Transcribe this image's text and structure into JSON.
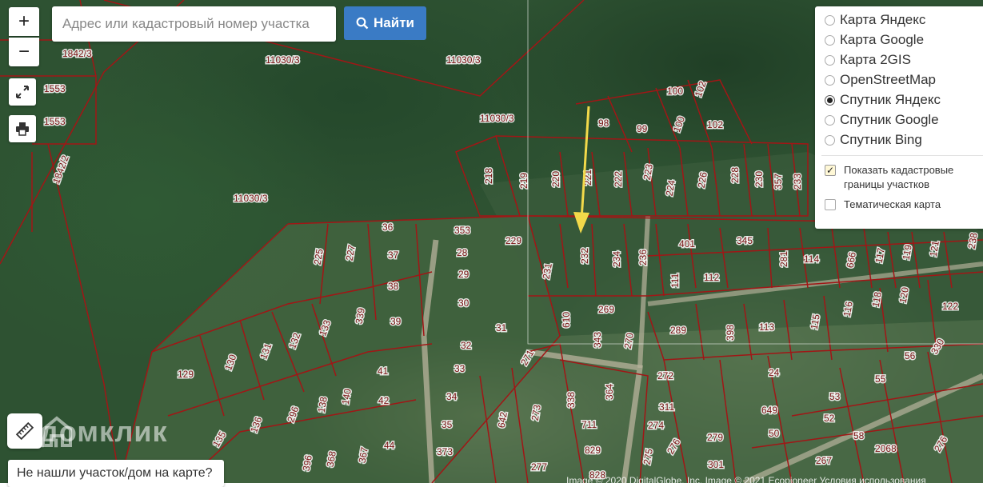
{
  "search": {
    "placeholder": "Адрес или кадастровый номер участка",
    "button_label": "Найти"
  },
  "controls": {
    "zoom_in_label": "+",
    "zoom_out_label": "−"
  },
  "layers": {
    "options": [
      {
        "label": "Карта Яндекс",
        "selected": false
      },
      {
        "label": "Карта Google",
        "selected": false
      },
      {
        "label": "Карта 2GIS",
        "selected": false
      },
      {
        "label": "OpenStreetMap",
        "selected": false
      },
      {
        "label": "Спутник Яндекс",
        "selected": true
      },
      {
        "label": "Спутник Google",
        "selected": false
      },
      {
        "label": "Спутник Bing",
        "selected": false
      }
    ],
    "show_cadastral": {
      "label": "Показать кадастровые границы участков",
      "checked": true
    },
    "thematic": {
      "label": "Тематическая карта",
      "checked": false
    }
  },
  "not_found_label": "Не нашли участок/дом на карте?",
  "watermark": "домклик",
  "copyright": "Image © 2020 DigitalGlobe, Inc.   Image © 2021 Ecopioneer   Условия использования",
  "plot_labels": [
    "1842/3",
    "11030/3",
    "11030/3",
    "1553",
    "1553",
    "11030/3",
    "1842/2",
    "11030/3",
    "98",
    "99",
    "100",
    "100",
    "102",
    "102",
    "218",
    "219",
    "220",
    "221",
    "222",
    "223",
    "224",
    "226",
    "228",
    "230",
    "357",
    "233",
    "36",
    "353",
    "229",
    "225",
    "227",
    "37",
    "28",
    "29",
    "38",
    "30",
    "231",
    "232",
    "234",
    "236",
    "401",
    "345",
    "281",
    "114",
    "666",
    "117",
    "119",
    "121",
    "238",
    "111",
    "112",
    "118",
    "120",
    "122",
    "39",
    "339",
    "133",
    "31",
    "269",
    "610",
    "343",
    "270",
    "289",
    "398",
    "113",
    "115",
    "116",
    "131",
    "132",
    "130",
    "129",
    "32",
    "271",
    "33",
    "56",
    "330",
    "41",
    "272",
    "24",
    "55",
    "140",
    "138",
    "42",
    "34",
    "338",
    "364",
    "53",
    "649",
    "311",
    "136",
    "296",
    "35",
    "273",
    "642",
    "274",
    "52",
    "58",
    "50",
    "135",
    "44",
    "711",
    "829",
    "279",
    "275",
    "373",
    "396",
    "368",
    "367",
    "277",
    "276",
    "301",
    "2068",
    "267",
    "828",
    "276"
  ]
}
